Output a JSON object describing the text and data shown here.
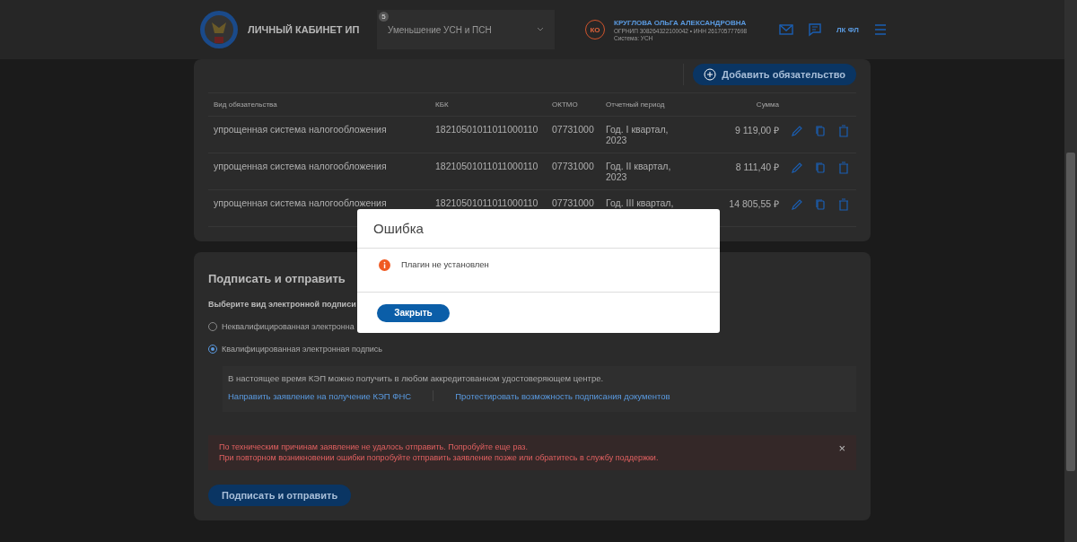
{
  "header": {
    "title": "ЛИЧНЫЙ КАБИНЕТ ИП",
    "selector": {
      "badge": "5",
      "value": "Уменьшение УСН и ПСН"
    },
    "user": {
      "initials": "КО",
      "name": "КРУГЛОВА ОЛЬГА АЛЕКСАНДРОВНА",
      "ids": "ОГРНИП 308264322100042 • ИНН 261705777698",
      "system": "Система: УСН"
    },
    "lk_link": "ЛК ФЛ"
  },
  "obligations": {
    "add_button": "Добавить обязательство",
    "columns": [
      "Вид обязательства",
      "КБК",
      "ОКТМО",
      "Отчетный период",
      "Сумма"
    ],
    "rows": [
      {
        "type": "упрощенная система налогообложения",
        "kbk": "18210501011011000110",
        "oktmo": "07731000",
        "period": "Год. I квартал, 2023",
        "sum": "9 119,00 ₽"
      },
      {
        "type": "упрощенная система налогообложения",
        "kbk": "18210501011011000110",
        "oktmo": "07731000",
        "period": "Год. II квартал, 2023",
        "sum": "8 111,40 ₽"
      },
      {
        "type": "упрощенная система налогообложения",
        "kbk": "18210501011011000110",
        "oktmo": "07731000",
        "period": "Год. III квартал,",
        "sum": "14 805,55 ₽"
      }
    ]
  },
  "sign": {
    "title": "Подписать и отправить",
    "prompt": "Выберите вид электронной подписи",
    "options": [
      {
        "label": "Неквалифицированная электронна",
        "selected": false
      },
      {
        "label": "Квалифицированная электронная подпись",
        "selected": true
      }
    ],
    "info": {
      "text": "В настоящее время КЭП можно получить в любом аккредитованном удостоверяющем центре.",
      "links": [
        "Направить заявление на получение КЭП ФНС",
        "Протестировать возможность подписания документов"
      ]
    },
    "error": {
      "lines": [
        "По техническим причинам заявление не удалось отправить. Попробуйте еще раз.",
        "При повторном возникновении ошибки попробуйте отправить заявление позже или обратитесь в службу поддержки."
      ],
      "close": "×"
    },
    "submit": "Подписать и отправить"
  },
  "dialog": {
    "title": "Ошибка",
    "message": "Плагин не установлен",
    "close": "Закрыть"
  }
}
